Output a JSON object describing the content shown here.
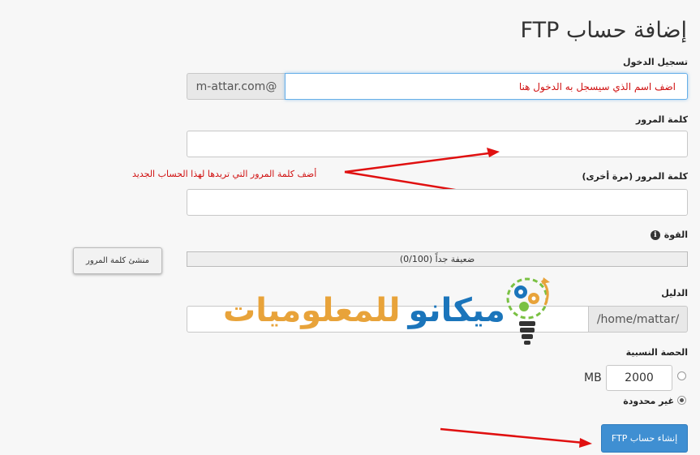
{
  "page": {
    "title": "إضافة حساب FTP"
  },
  "login": {
    "label": "تسجيل الدخول",
    "domain_suffix": "m-attar.com@",
    "annotation": "اضف اسم الذي سيسجل به الدخول هنا"
  },
  "password": {
    "label": "كلمة المرور",
    "value": ""
  },
  "password_again": {
    "label": "كلمة المرور (مرة أخرى)",
    "value": ""
  },
  "password_annotation": "أضف كلمة المرور التي تريدها لهذا الحساب الجديد",
  "strength": {
    "label": "القوة",
    "meter_text": "ضعيفة جداً (0/100)",
    "value_percent": 0,
    "generator_button": "منشئ كلمة المرور"
  },
  "directory": {
    "label": "الدليل",
    "prefix": "/home/mattar/",
    "value": ""
  },
  "watermark": {
    "text_part1": "ميكانو",
    "text_part2": "للمعلوميات",
    "color1": "#1b75bb",
    "color2": "#e8a33a"
  },
  "quota": {
    "label": "الحصة النسبية",
    "amount": "2000",
    "unit": "MB",
    "unlimited_label": "غير محدودة",
    "selected": "unlimited"
  },
  "submit_button": "إنشاء حساب FTP",
  "colors": {
    "accent": "#3f8fd2",
    "annotation": "#d01010",
    "focus_border": "#66afe9"
  }
}
